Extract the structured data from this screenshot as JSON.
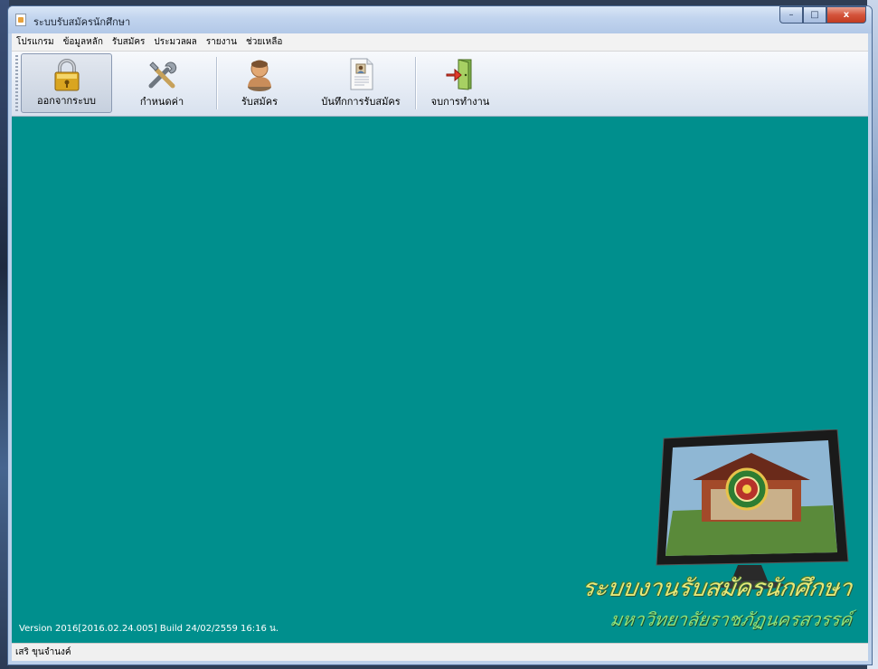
{
  "window": {
    "title": "ระบบรับสมัครนักศึกษา",
    "controls": {
      "minimize": "–",
      "maximize": "□",
      "close": "x"
    }
  },
  "menubar": {
    "items": [
      "โปรแกรม",
      "ข้อมูลหลัก",
      "รับสมัคร",
      "ประมวลผล",
      "รายงาน",
      "ช่วยเหลือ"
    ]
  },
  "toolbar": {
    "buttons": [
      {
        "label": "ออกจากระบบ",
        "icon": "lock-icon"
      },
      {
        "label": "กำหนดค่า",
        "icon": "tools-icon"
      },
      {
        "label": "รับสมัคร",
        "icon": "user-icon"
      },
      {
        "label": "บันทึกการรับสมัคร",
        "icon": "document-icon"
      },
      {
        "label": "จบการทำงาน",
        "icon": "exit-door-icon"
      }
    ]
  },
  "client": {
    "background_color": "#008f8d",
    "version_text": "Version 2016[2016.02.24.005] Build 24/02/2559 16:16 น.",
    "brand_line1": "ระบบงานรับสมัครนักศึกษา",
    "brand_line2": "มหาวิทยาลัยราชภัฏนครสวรรค์"
  },
  "statusbar": {
    "user": "เสริ ขุนจำนงค์"
  }
}
